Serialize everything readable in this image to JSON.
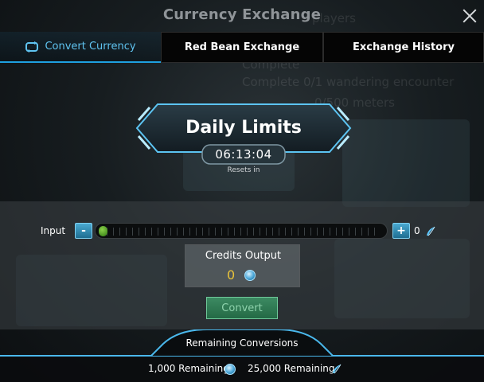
{
  "window": {
    "title": "Currency Exchange"
  },
  "tabs": [
    {
      "label": "Convert Currency",
      "active": true
    },
    {
      "label": "Red Bean Exchange",
      "active": false
    },
    {
      "label": "Exchange History",
      "active": false
    }
  ],
  "background_text": {
    "line1": "players",
    "line2": "Complete 0/1 wandering encounter",
    "line3": "0/500 meters",
    "line4": "Complete"
  },
  "daily_limits": {
    "title": "Daily Limits",
    "timer": "06:13:04",
    "resets_label": "Resets in"
  },
  "input": {
    "label": "Input",
    "minus": "-",
    "plus": "+",
    "value": "0",
    "slider_fraction": 0
  },
  "credits_output": {
    "label": "Credits Output",
    "value": "0"
  },
  "convert_button": "Convert",
  "remaining": {
    "title": "Remaining Conversions",
    "credits_remaining": "1,000 Remaining",
    "feathers_remaining": "25,000 Remaining"
  },
  "colors": {
    "accent": "#1ea0e0",
    "credits_value": "#e8c23a",
    "convert": "#2f7a52"
  },
  "icons": {
    "tab": "swap-arrows-icon",
    "currency_input": "feather-icon",
    "currency_output": "credit-coin-icon"
  }
}
